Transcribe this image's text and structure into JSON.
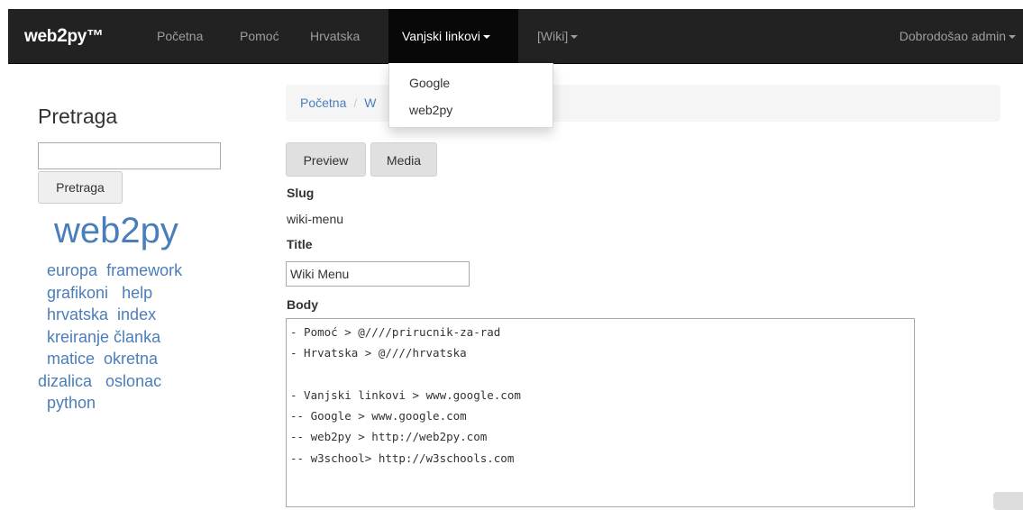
{
  "navbar": {
    "brand_prefix": "web",
    "brand_big": "2",
    "brand_suffix": "py™",
    "items": [
      {
        "label": "Početna"
      },
      {
        "label": "Pomoć"
      },
      {
        "label": "Hrvatska"
      },
      {
        "label": "Vanjski linkovi"
      },
      {
        "label": "[Wiki]"
      }
    ],
    "user_label": "Dobrodošao admin"
  },
  "dropdown": {
    "items": [
      {
        "label": "Google"
      },
      {
        "label": "web2py"
      }
    ]
  },
  "sidebar": {
    "search_title": "Pretraga",
    "search_value": "",
    "search_button": "Pretraga",
    "tag_main": "web2py",
    "tags": [
      "europa",
      "framework",
      "grafikoni",
      "help",
      "hrvatska",
      "index",
      "kreiranje",
      "članka",
      "matice",
      "okretna",
      "dizalica",
      "oslonac",
      "python"
    ]
  },
  "breadcrumb": {
    "home": "Početna",
    "separator": "/",
    "current_partial": "W"
  },
  "editor": {
    "preview_button": "Preview",
    "media_button": "Media",
    "slug_label": "Slug",
    "slug_value": "wiki-menu",
    "title_label": "Title",
    "title_value": "Wiki Menu",
    "body_label": "Body",
    "body_value": "- Pomoć > @////prirucnik-za-rad\n- Hrvatska > @////hrvatska\n\n- Vanjski linkovi > www.google.com\n-- Google > www.google.com\n-- web2py > http://web2py.com\n-- w3school> http://w3schools.com"
  }
}
